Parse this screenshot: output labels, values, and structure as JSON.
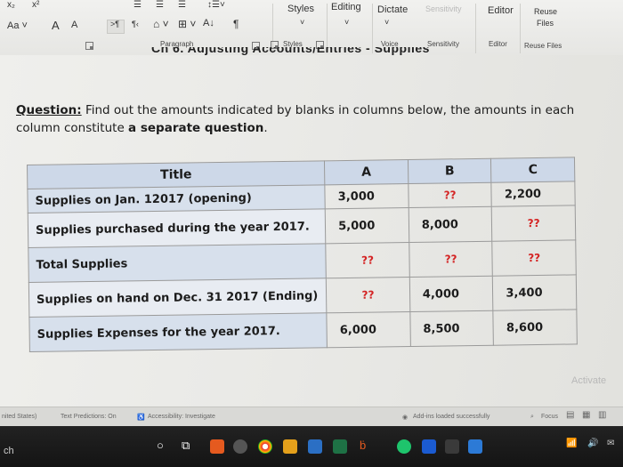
{
  "ribbon": {
    "font_size_label": "Aa",
    "grow_font": "A",
    "shrink_font": "A",
    "paragraph_group_label": "Paragraph",
    "styles_button": "Styles",
    "styles_group_label": "Styles",
    "editing_button": "Editing",
    "dictate_button": "Dictate",
    "voice_group_label": "Voice",
    "sensitivity_button": "Sensitivity",
    "sensitivity_group_label": "Sensitivity",
    "editor_button": "Editor",
    "editor_group_label": "Editor",
    "reuse_files_button_line1": "Reuse",
    "reuse_files_button_line2": "Files",
    "reuse_files_group_label": "Reuse Files",
    "pilcrow": "¶",
    "sort_icon_text": "A↓"
  },
  "document": {
    "cut_heading": "Ch 6. Adjusting Accounts/Entries - Supplies",
    "question_label": "Question:",
    "question_text": " Find out the amounts indicated by blanks in columns below, the amounts in each column constitute ",
    "question_bold": "a separate question",
    "question_end": ".",
    "activate_text": "Activate"
  },
  "table": {
    "headers": [
      "Title",
      "A",
      "B",
      "C"
    ],
    "rows": [
      {
        "title": "Supplies on Jan. 12017 (opening)",
        "a": "3,000",
        "b": "??",
        "c": "2,200"
      },
      {
        "title": "Supplies purchased during the year 2017.",
        "a": "5,000",
        "b": "8,000",
        "c": "??"
      },
      {
        "title": "Total Supplies",
        "a": "??",
        "b": "??",
        "c": "??"
      },
      {
        "title": "Supplies on hand on Dec. 31 2017 (Ending)",
        "a": "??",
        "b": "4,000",
        "c": "3,400"
      },
      {
        "title": "Supplies Expenses for the year 2017.",
        "a": "6,000",
        "b": "8,500",
        "c": "8,600"
      }
    ]
  },
  "statusbar": {
    "language": "nited States)",
    "text_predictions": "Text Predictions: On",
    "accessibility": "Accessibility: Investigate",
    "addins": "Add-ins loaded successfully",
    "focus": "Focus"
  },
  "taskbar": {
    "search_text": "ch"
  }
}
